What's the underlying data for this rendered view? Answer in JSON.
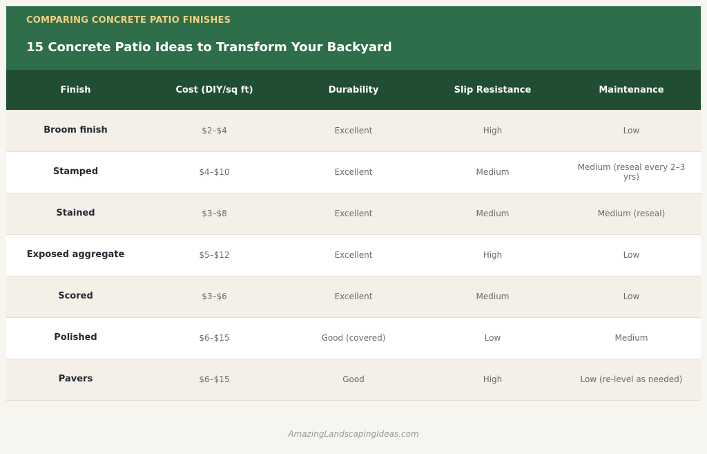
{
  "header": {
    "eyebrow": "COMPARING CONCRETE PATIO FINISHES",
    "title": "15 Concrete Patio Ideas to Transform Your Backyard"
  },
  "table": {
    "columns": [
      "Finish",
      "Cost (DIY/sq ft)",
      "Durability",
      "Slip Resistance",
      "Maintenance"
    ],
    "rows": [
      [
        "Broom finish",
        "$2–$4",
        "Excellent",
        "High",
        "Low"
      ],
      [
        "Stamped",
        "$4–$10",
        "Excellent",
        "Medium",
        "Medium (reseal every 2–3 yrs)"
      ],
      [
        "Stained",
        "$3–$8",
        "Excellent",
        "Medium",
        "Medium (reseal)"
      ],
      [
        "Exposed aggregate",
        "$5–$12",
        "Excellent",
        "High",
        "Low"
      ],
      [
        "Scored",
        "$3–$6",
        "Excellent",
        "Medium",
        "Low"
      ],
      [
        "Polished",
        "$6–$15",
        "Good (covered)",
        "Low",
        "Medium"
      ],
      [
        "Pavers",
        "$6–$15",
        "Good",
        "High",
        "Low (re-level as needed)"
      ]
    ]
  },
  "footer": {
    "credit": "AmazingLandscapingIdeas.com"
  },
  "colors": {
    "banner": "#2f6e4b",
    "header_row": "#214d32",
    "eyebrow": "#f0d080",
    "row_alt": "#f4efe7"
  }
}
